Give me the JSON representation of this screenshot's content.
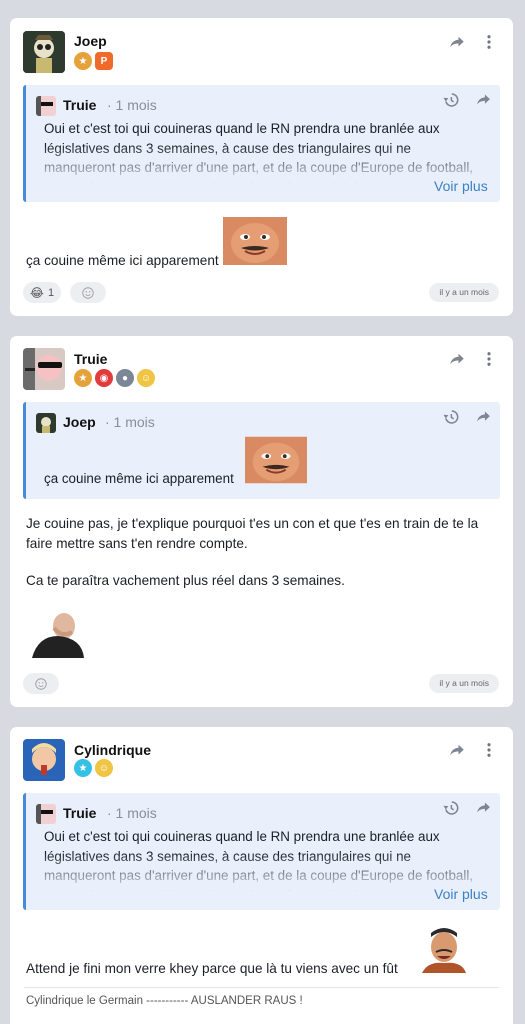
{
  "posts": [
    {
      "author": "Joep",
      "quote": {
        "author": "Truie",
        "time": "· 1 mois",
        "text": "Oui et c'est toi qui couineras quand le RN prendra une branlée aux législatives dans 3 semaines, à cause des triangulaires qui ne manqueront pas d'arriver d'une part, et de la coupe d'Europe de football, ou les classes populaires qui constituent l'essentiel de",
        "more": "Voir plus"
      },
      "message": "ça couine même ici apparement",
      "reaction_count": "1",
      "timestamp": "il y a un mois"
    },
    {
      "author": "Truie",
      "quote": {
        "author": "Joep",
        "time": "· 1 mois",
        "text": "ça couine même ici apparement"
      },
      "message1": "Je couine pas, je t'explique pourquoi t'es un con et que t'es en train de te la faire mettre sans t'en rendre compte.",
      "message2": "Ca te paraîtra vachement plus réel dans 3 semaines.",
      "timestamp": "il y a un mois"
    },
    {
      "author": "Cylindrique",
      "quote": {
        "author": "Truie",
        "time": "· 1 mois",
        "text": "Oui et c'est toi qui couineras quand le RN prendra une branlée aux législatives dans 3 semaines, à cause des triangulaires qui ne manqueront pas d'arriver d'une part, et de la coupe d'Europe de football, ou les classes populaires qui constituent l'essentiel de",
        "more": "Voir plus"
      },
      "message": "Attend je fini mon verre khey parce que là tu viens avec un fût",
      "signature": "Cylindrique le Germain ----------- AUSLANDER RAUS !"
    }
  ],
  "colors": {
    "accent": "#4a88d8",
    "link": "#3b82c4",
    "background": "#d7dae1"
  },
  "icons": [
    "share-icon",
    "more-icon",
    "history-icon",
    "smiley-icon",
    "laughing-emoji-icon"
  ]
}
